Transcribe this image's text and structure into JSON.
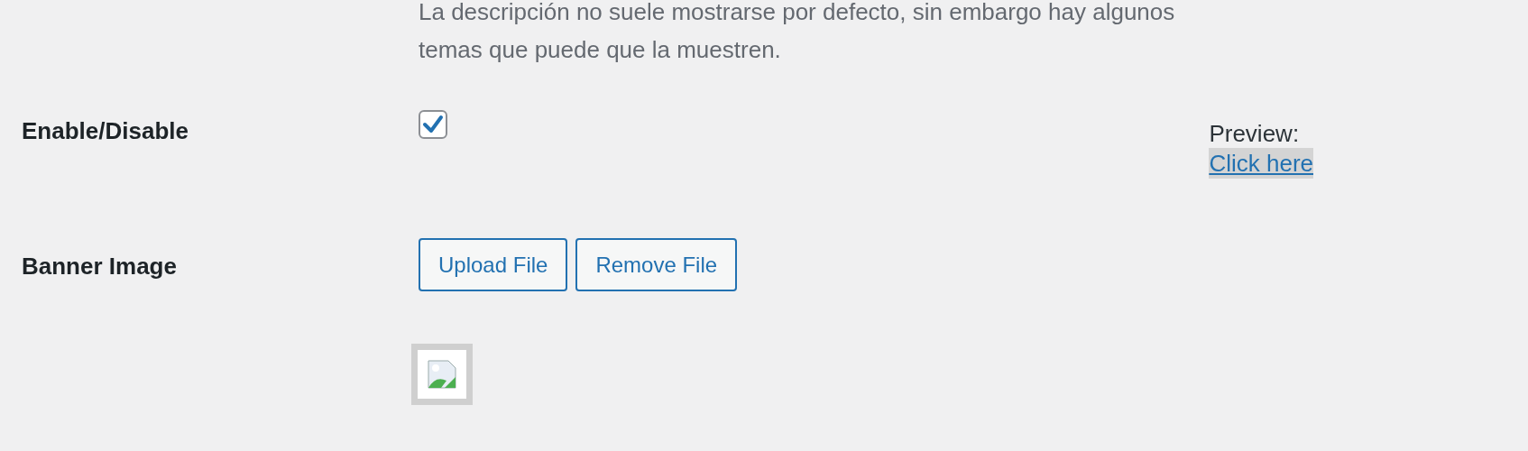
{
  "description": "La descripción no suele mostrarse por defecto, sin embargo hay algunos temas que puede que la muestren.",
  "enable": {
    "label": "Enable/Disable",
    "checked": true,
    "preview_label": "Preview:",
    "preview_link": "Click here"
  },
  "banner": {
    "label": "Banner Image",
    "buttons": [
      "Upload File",
      "Remove File"
    ],
    "image": {
      "kind": "broken-image"
    }
  }
}
